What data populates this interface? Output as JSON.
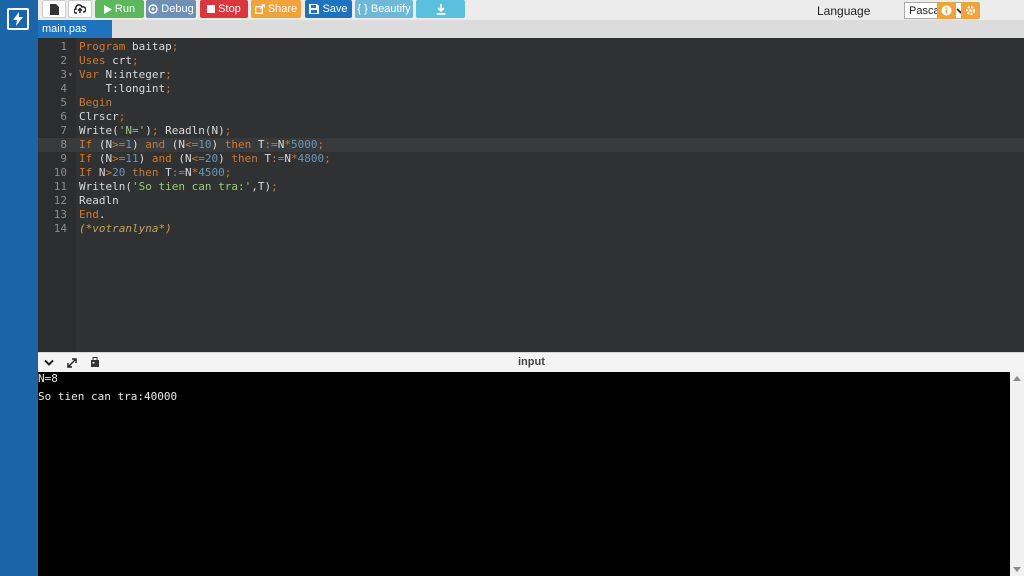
{
  "toolbar": {
    "run_label": "Run",
    "debug_label": "Debug",
    "stop_label": "Stop",
    "share_label": "Share",
    "save_label": "Save",
    "beautify_label": "{ } Beautify",
    "language_label": "Language",
    "language_value": "Pascal"
  },
  "colors": {
    "sidebar": "#1a64a8",
    "run": "#5cb85c",
    "debug": "#6f8fb3",
    "stop": "#d9363e",
    "share": "#f0a33a",
    "save": "#1e73be",
    "beautify": "#6fb7d6",
    "download": "#5bc0de"
  },
  "file_tab": "main.pas",
  "code_lines": [
    {
      "n": "1"
    },
    {
      "n": "2"
    },
    {
      "n": "3"
    },
    {
      "n": "4"
    },
    {
      "n": "5"
    },
    {
      "n": "6"
    },
    {
      "n": "7"
    },
    {
      "n": "8"
    },
    {
      "n": "9"
    },
    {
      "n": "10"
    },
    {
      "n": "11"
    },
    {
      "n": "12"
    },
    {
      "n": "13"
    },
    {
      "n": "14"
    }
  ],
  "code": {
    "l1_kw": "Program",
    "l1_rest": " baitap",
    "l1_semi": ";",
    "l2_kw": "Uses",
    "l2_rest": " crt",
    "l2_semi": ";",
    "l3_kw": "Var",
    "l3_rest": " N:integer",
    "l3_semi": ";",
    "l4_rest": "    T:longint",
    "l4_semi": ";",
    "l5_kw": "Begin",
    "l6_rest": "Clrscr",
    "l6_semi": ";",
    "l7_a": "Write(",
    "l7_str": "'N='",
    "l7_b": ")",
    "l7_semi": ";",
    "l7_c": " Readln(N)",
    "l7_semi2": ";",
    "l8_if": "If",
    "l8_a": " (N",
    "l8_op": ">=",
    "l8_n1": "1",
    "l8_b": ") ",
    "l8_and": "and",
    "l8_c": " (N",
    "l8_op2": "<=",
    "l8_n2": "10",
    "l8_d": ") ",
    "l8_then": "then",
    "l8_e": " T",
    "l8_op3": ":=",
    "l8_f": "N",
    "l8_op4": "*",
    "l8_n3": "5000",
    "l8_semi": ";",
    "l9_if": "If",
    "l9_a": " (N",
    "l9_op": ">=",
    "l9_n1": "11",
    "l9_b": ") ",
    "l9_and": "and",
    "l9_c": " (N",
    "l9_op2": "<=",
    "l9_n2": "20",
    "l9_d": ") ",
    "l9_then": "then",
    "l9_e": " T",
    "l9_op3": ":=",
    "l9_f": "N",
    "l9_op4": "*",
    "l9_n3": "4800",
    "l9_semi": ";",
    "l10_if": "If",
    "l10_a": " N",
    "l10_op": ">",
    "l10_n1": "20",
    "l10_b": " ",
    "l10_then": "then",
    "l10_e": " T",
    "l10_op3": ":=",
    "l10_f": "N",
    "l10_op4": "*",
    "l10_n3": "4500",
    "l10_semi": ";",
    "l11_a": "Writeln(",
    "l11_str": "'So tien can tra:'",
    "l11_b": ",T)",
    "l11_semi": ";",
    "l12_rest": "Readln",
    "l13_kw": "End",
    "l13_dot": ".",
    "l14_cm": "(*votranlyna*)"
  },
  "pane_title": "input",
  "console_lines": [
    "N=8",
    "So tien can tra:40000"
  ]
}
